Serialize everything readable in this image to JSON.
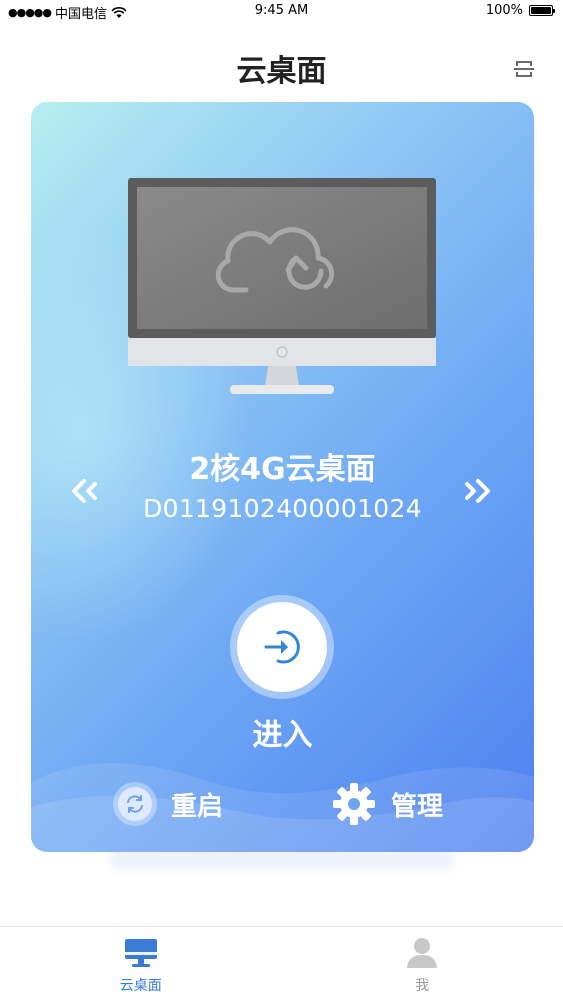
{
  "status_bar": {
    "carrier": "中国电信",
    "time": "9:45 AM",
    "battery": "100%"
  },
  "header": {
    "title": "云桌面"
  },
  "card": {
    "desktop_name": "2核4G云桌面",
    "desktop_id": "D0119102400001024",
    "enter_label": "进入",
    "restart_label": "重启",
    "manage_label": "管理"
  },
  "tabs": [
    {
      "label": "云桌面",
      "icon": "desktop-icon",
      "active": true
    },
    {
      "label": "我",
      "icon": "person-icon",
      "active": false
    }
  ],
  "colors": {
    "accent": "#3a7bd5",
    "card_start": "#b6eef0",
    "card_end": "#4d7ff0"
  }
}
